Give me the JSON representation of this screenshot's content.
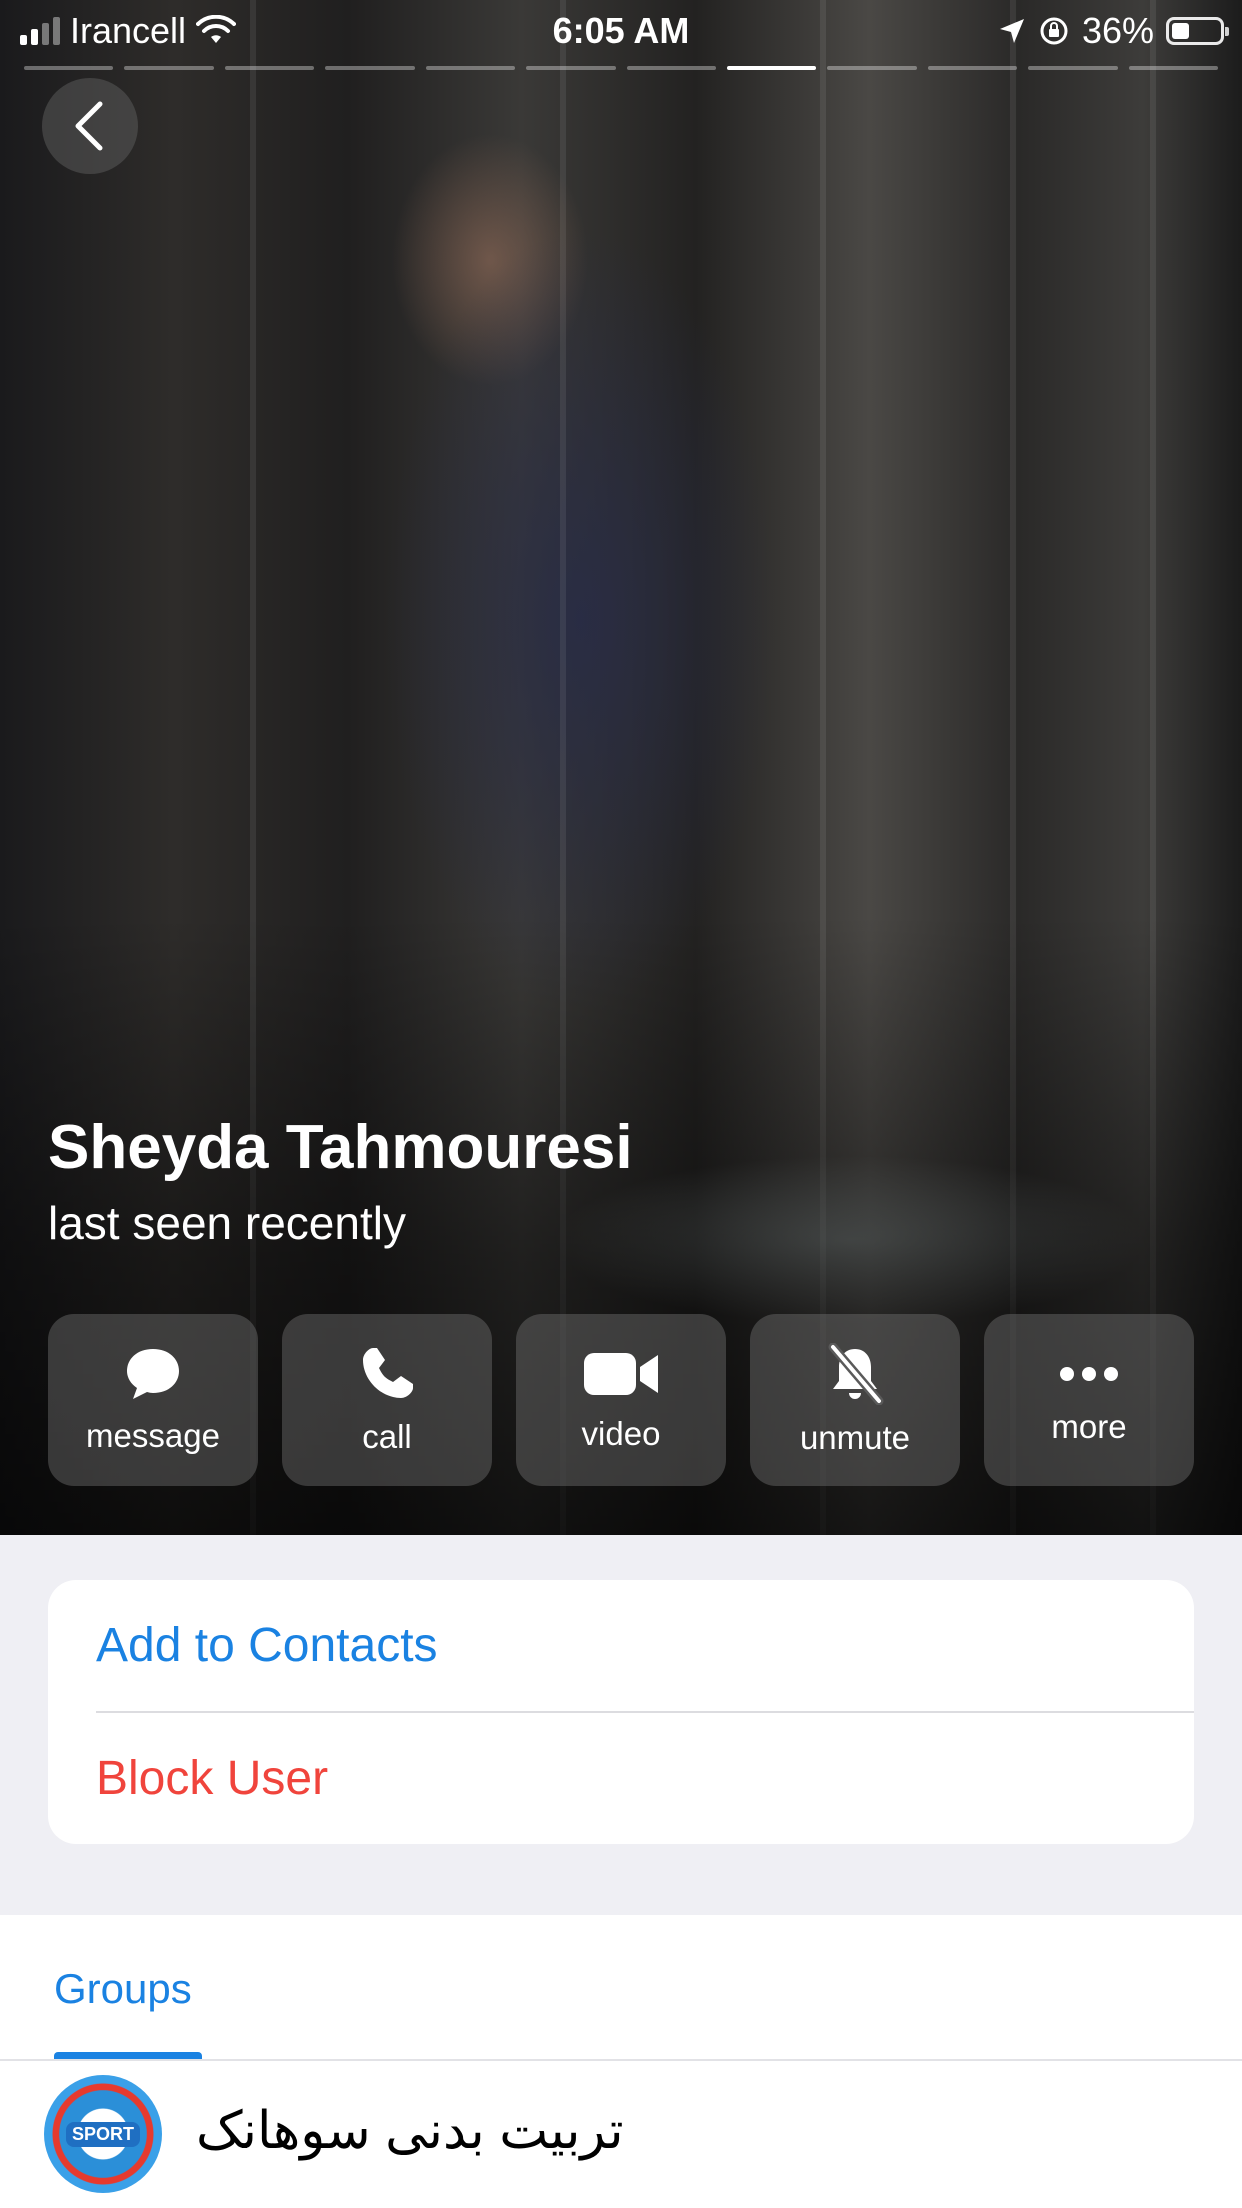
{
  "status_bar": {
    "carrier": "Irancell",
    "time": "6:05 AM",
    "battery": "36%",
    "battery_level": 0.36,
    "signal_icon": "signal-bars-icon",
    "wifi_icon": "wifi-icon",
    "location_icon": "location-arrow-icon",
    "rotation_lock_icon": "rotation-lock-icon"
  },
  "story": {
    "segments": 12,
    "active_index": 7
  },
  "profile": {
    "name": "Sheyda Tahmouresi",
    "presence": "last seen recently"
  },
  "actions": [
    {
      "label": "message",
      "icon": "message-bubble-icon"
    },
    {
      "label": "call",
      "icon": "phone-icon"
    },
    {
      "label": "video",
      "icon": "video-camera-icon"
    },
    {
      "label": "unmute",
      "icon": "bell-slash-icon"
    },
    {
      "label": "more",
      "icon": "ellipsis-icon"
    }
  ],
  "options": {
    "add_contact": "Add to Contacts",
    "block_user": "Block User"
  },
  "groups": {
    "tab_label": "Groups",
    "items": [
      {
        "title": "تربیت بدنی سوهانک",
        "avatar_badge": "SPORT"
      }
    ]
  },
  "colors": {
    "accent": "#1a82e2",
    "destructive": "#f0443c",
    "page_background": "#efeff4"
  }
}
